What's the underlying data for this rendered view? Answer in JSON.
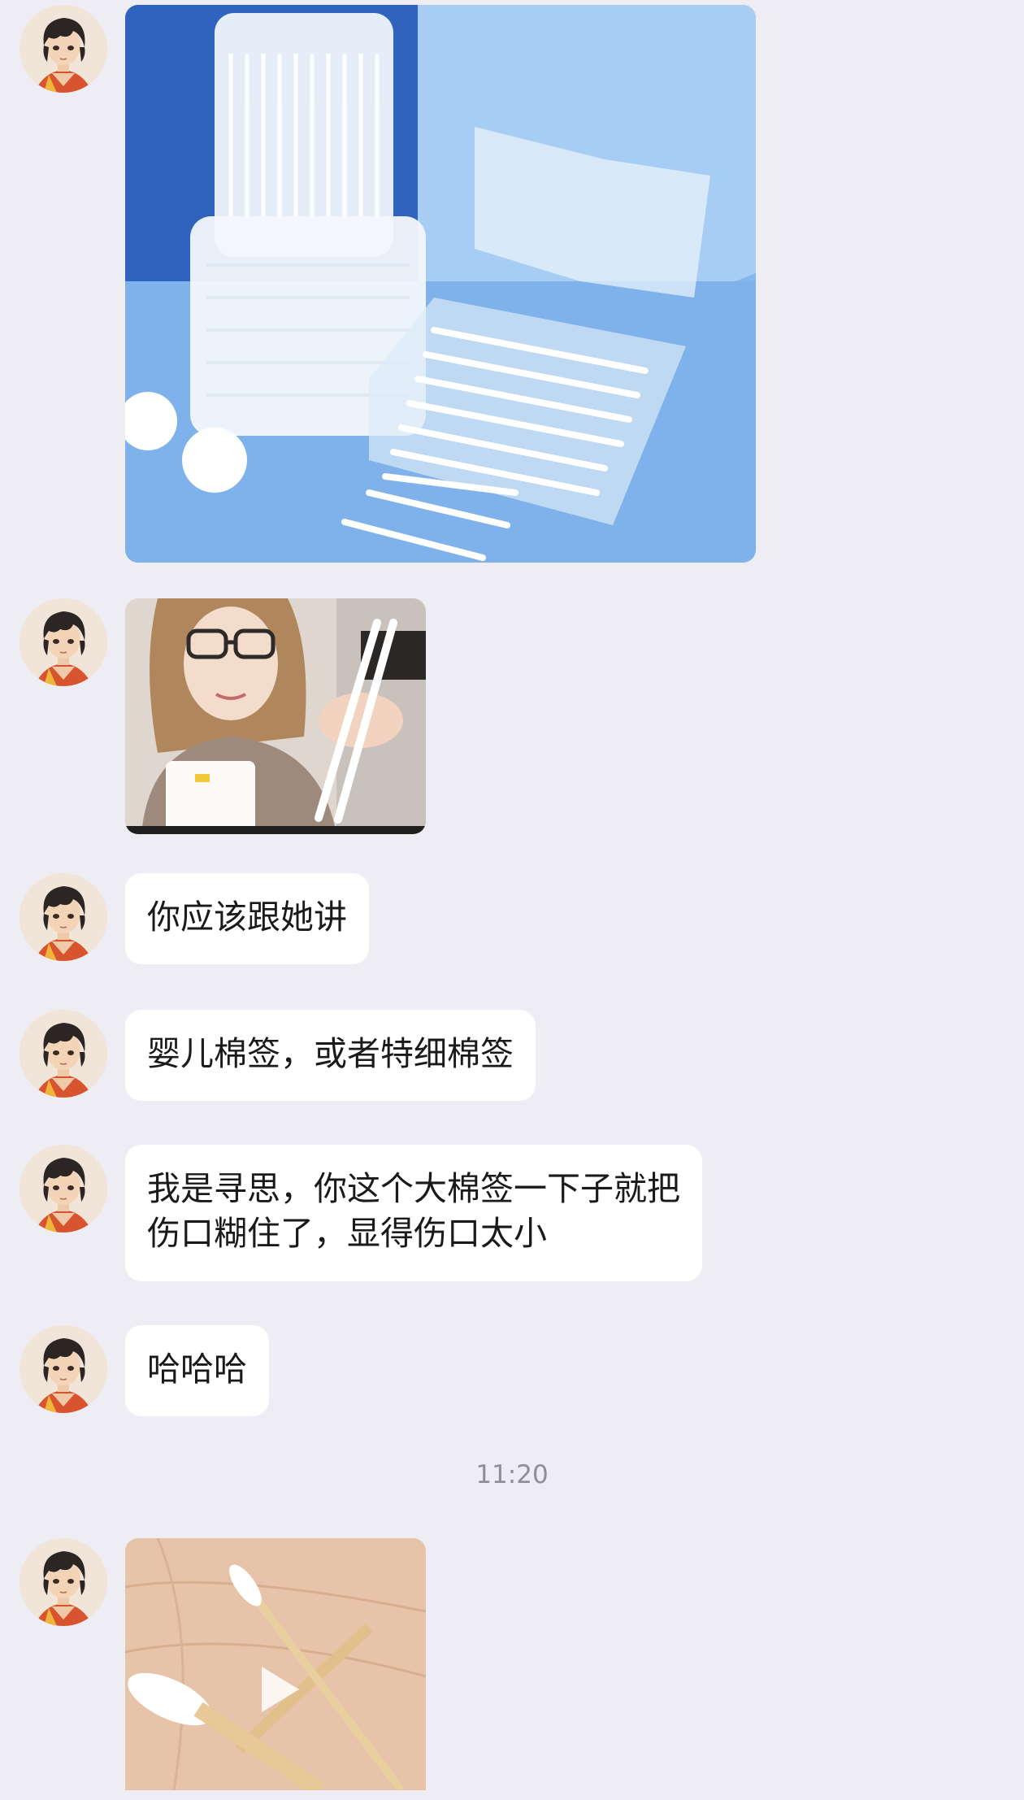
{
  "chat": {
    "messages": [
      {
        "type": "image",
        "sender_avatar": "anime-boy-avatar",
        "subject": "cotton-swabs-product-photo"
      },
      {
        "type": "video",
        "sender_avatar": "anime-boy-avatar",
        "subject": "woman-holding-cotton-swabs"
      },
      {
        "type": "text",
        "sender_avatar": "anime-boy-avatar",
        "text": "你应该跟她讲"
      },
      {
        "type": "text",
        "sender_avatar": "anime-boy-avatar",
        "text": "婴儿棉签，或者特细棉签"
      },
      {
        "type": "text",
        "sender_avatar": "anime-boy-avatar",
        "lines": [
          "我是寻思，你这个大棉签一下子就把",
          "伤口糊住了，显得伤口太小"
        ]
      },
      {
        "type": "text",
        "sender_avatar": "anime-boy-avatar",
        "text": "哈哈哈"
      },
      {
        "type": "video",
        "sender_avatar": "anime-boy-avatar",
        "subject": "cotton-swab-comparison-on-hand"
      }
    ],
    "timestamp": "11:20"
  },
  "colors": {
    "background": "#ededf3",
    "bubble": "#ffffff",
    "text": "#1a1a1a",
    "timestamp": "#8e8e95"
  }
}
